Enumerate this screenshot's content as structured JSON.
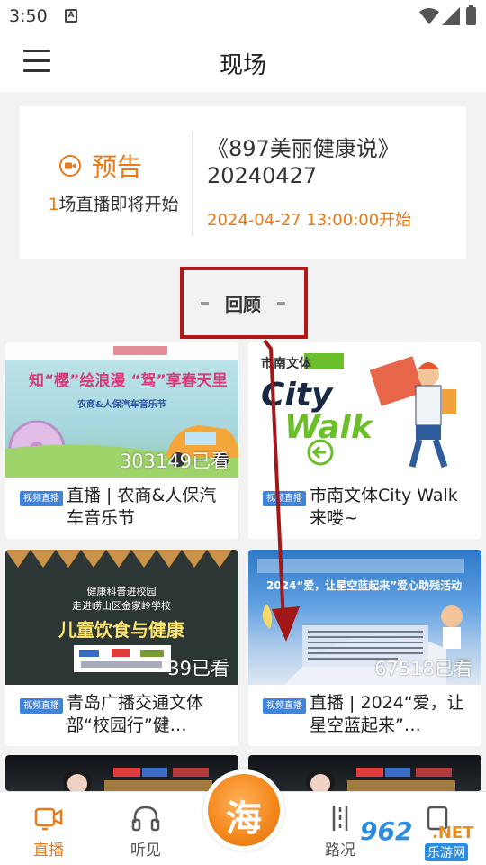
{
  "status_bar": {
    "time": "3:50",
    "notification_icon": "A"
  },
  "header": {
    "title": "现场",
    "menu_icon": "hamburger-menu-icon"
  },
  "preview": {
    "label": "预告",
    "sub_count": "1",
    "sub_text": "场直播即将开始",
    "title": "《897美丽健康说》20240427",
    "time": "2024-04-27 13:00:00开始",
    "accent": "#e87a18"
  },
  "review": {
    "title": "回顾"
  },
  "cards": [
    {
      "badge": "视频直播",
      "title": "直播 | 农商&人保汽车音乐节",
      "views": "303149已看",
      "thumb_text_1": "知“樱”绘浪漫 “驾”享春天里",
      "thumb_text_2": "农商&人保汽车音乐节"
    },
    {
      "badge": "视频直播",
      "title": "市南文体City Walk来喽~",
      "views": "",
      "thumb_text_1": "市南文体",
      "thumb_text_2": "City",
      "thumb_text_3": "Walk"
    },
    {
      "badge": "视频直播",
      "title": "青岛广播交通文体部“校园行”健…",
      "views": "39已看",
      "thumb_text_1": "健康科普进校园",
      "thumb_text_2": "走进崂山区金家岭学校",
      "thumb_text_3": "儿童饮食与健康"
    },
    {
      "badge": "视频直播",
      "title": "直播 | 2024“爱，让星空蓝起来”…",
      "views": "67518已看",
      "thumb_text_1": "2024“爱，让星空蓝起来”爱心助残活动"
    }
  ],
  "tabbar": {
    "tabs": [
      {
        "label": "直播",
        "icon": "live-camera-icon",
        "active": true
      },
      {
        "label": "听见",
        "icon": "headphones-icon",
        "active": false
      },
      {
        "label": "海",
        "icon": "center-logo",
        "active": false
      },
      {
        "label": "路况",
        "icon": "road-icon",
        "active": false
      },
      {
        "label": "",
        "icon": "device-icon",
        "active": false
      }
    ]
  },
  "watermark": {
    "number": "962",
    "net": ".NET",
    "sub": "乐游网"
  },
  "colors": {
    "accent": "#e87a18",
    "badge": "#3d83e0",
    "highlight": "#b01818"
  }
}
